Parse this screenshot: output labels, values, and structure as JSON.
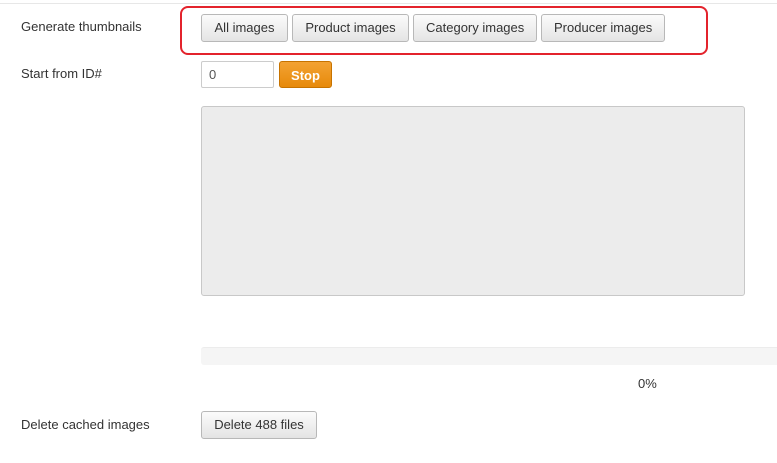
{
  "thumbnails": {
    "label": "Generate thumbnails",
    "buttons": [
      "All images",
      "Product images",
      "Category images",
      "Producer images"
    ]
  },
  "start": {
    "label": "Start from ID#",
    "value": "0",
    "stop_label": "Stop"
  },
  "log": {
    "value": ""
  },
  "progress": {
    "percent_text": "0%",
    "fraction": 0
  },
  "cache": {
    "label": "Delete cached images",
    "button_label": "Delete 488 files"
  },
  "colors": {
    "accent": "#e78a0b",
    "highlight": "#e3232c"
  }
}
